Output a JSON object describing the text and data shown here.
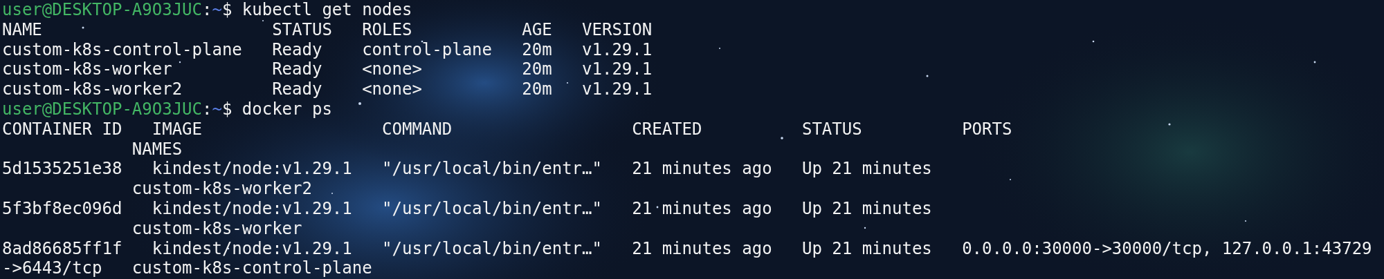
{
  "terminal": {
    "lines": [
      {
        "kind": "prompt",
        "user_host": "user@DESKTOP-A9O3JUC",
        "separator": ":",
        "path": "~",
        "command": "$ kubectl get nodes"
      },
      {
        "kind": "output",
        "text": "NAME                       STATUS   ROLES           AGE   VERSION"
      },
      {
        "kind": "output",
        "text": "custom-k8s-control-plane   Ready    control-plane   20m   v1.29.1"
      },
      {
        "kind": "output",
        "text": "custom-k8s-worker          Ready    <none>          20m   v1.29.1"
      },
      {
        "kind": "output",
        "text": "custom-k8s-worker2         Ready    <none>          20m   v1.29.1"
      },
      {
        "kind": "prompt",
        "user_host": "user@DESKTOP-A9O3JUC",
        "separator": ":",
        "path": "~",
        "command": "$ docker ps"
      },
      {
        "kind": "output",
        "text": "CONTAINER ID   IMAGE                  COMMAND                  CREATED          STATUS          PORTS"
      },
      {
        "kind": "output",
        "text": "             NAMES"
      },
      {
        "kind": "output",
        "text": "5d1535251e38   kindest/node:v1.29.1   \"/usr/local/bin/entr…\"   21 minutes ago   Up 21 minutes"
      },
      {
        "kind": "output",
        "text": "             custom-k8s-worker2"
      },
      {
        "kind": "output",
        "text": "5f3bf8ec096d   kindest/node:v1.29.1   \"/usr/local/bin/entr…\"   21 minutes ago   Up 21 minutes"
      },
      {
        "kind": "output",
        "text": "             custom-k8s-worker"
      },
      {
        "kind": "output",
        "text": "8ad86685ff1f   kindest/node:v1.29.1   \"/usr/local/bin/entr…\"   21 minutes ago   Up 21 minutes   0.0.0.0:30000->30000/tcp, 127.0.0.1:43729"
      },
      {
        "kind": "output",
        "text": "->6443/tcp   custom-k8s-control-plane"
      }
    ]
  }
}
